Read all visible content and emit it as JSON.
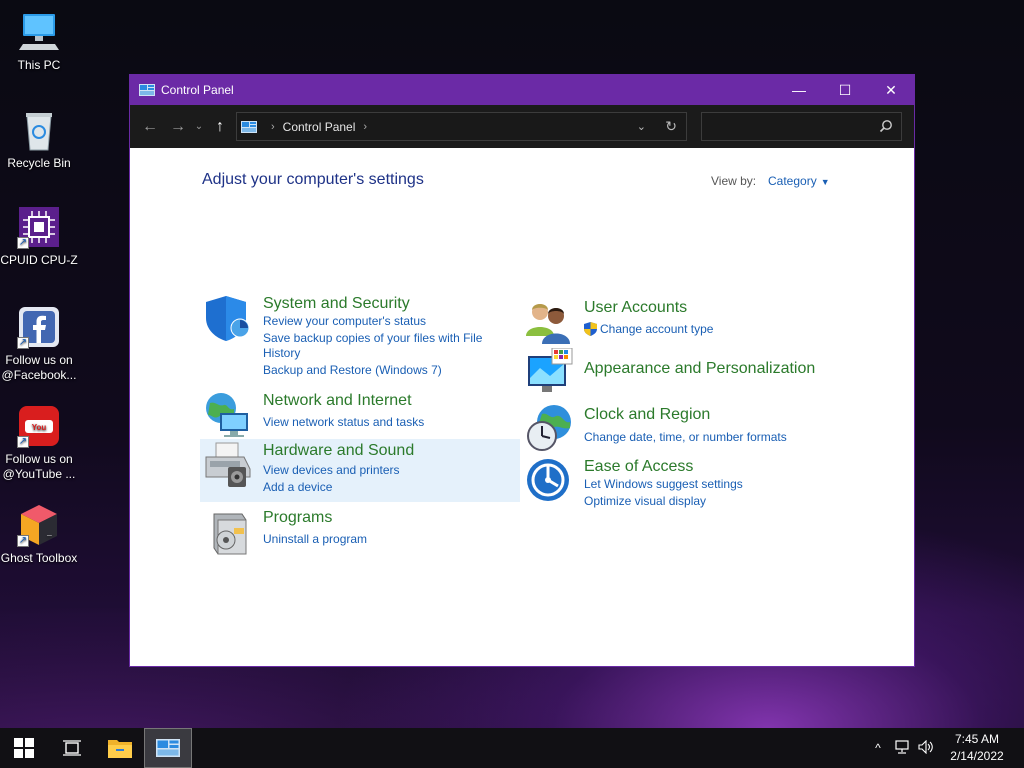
{
  "desktop": {
    "icons": [
      {
        "label": "This PC"
      },
      {
        "label": "Recycle Bin"
      },
      {
        "label": "CPUID CPU-Z"
      },
      {
        "label": "Follow us on @Facebook..."
      },
      {
        "label": "Follow us on @YouTube ..."
      },
      {
        "label": "Ghost Toolbox"
      }
    ]
  },
  "window": {
    "title": "Control Panel",
    "controls": {
      "minimize": "—",
      "maximize": "☐",
      "close": "✕"
    },
    "nav": {
      "back": "←",
      "forward": "→",
      "recent": "⌄",
      "up": "↑"
    },
    "address": {
      "crumb": "Control Panel",
      "sep1": "›",
      "sep2": "›",
      "dropdown": "⌄",
      "refresh": "↻"
    },
    "search": {
      "value": "",
      "placeholder": ""
    }
  },
  "content": {
    "heading": "Adjust your computer's settings",
    "view_by_label": "View by:",
    "view_by_value": "Category",
    "categories": [
      {
        "title": "System and Security",
        "links": [
          "Review your computer's status",
          "Save backup copies of your files with File",
          "History",
          "Backup and Restore (Windows 7)"
        ]
      },
      {
        "title": "Network and Internet",
        "links": [
          "View network status and tasks"
        ]
      },
      {
        "title": "Hardware and Sound",
        "links": [
          "View devices and printers",
          "Add a device"
        ]
      },
      {
        "title": "Programs",
        "links": [
          "Uninstall a program"
        ]
      },
      {
        "title": "User Accounts",
        "links": [
          "Change account type"
        ]
      },
      {
        "title": "Appearance and Personalization",
        "links": []
      },
      {
        "title": "Clock and Region",
        "links": [
          "Change date, time, or number formats"
        ]
      },
      {
        "title": "Ease of Access",
        "links": [
          "Let Windows suggest settings",
          "Optimize visual display"
        ]
      }
    ]
  },
  "taskbar": {
    "clock_time": "7:45 AM",
    "clock_date": "2/14/2022",
    "tray_chevron": "^"
  }
}
